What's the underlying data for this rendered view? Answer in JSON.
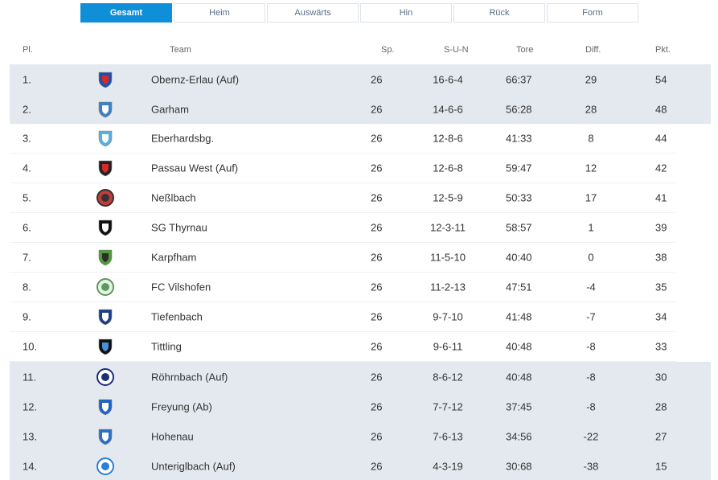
{
  "tabs": [
    {
      "label": "Gesamt",
      "active": true
    },
    {
      "label": "Heim",
      "active": false
    },
    {
      "label": "Auswärts",
      "active": false
    },
    {
      "label": "Hin",
      "active": false
    },
    {
      "label": "Rück",
      "active": false
    },
    {
      "label": "Form",
      "active": false
    }
  ],
  "headers": {
    "pl": "Pl.",
    "team": "Team",
    "sp": "Sp.",
    "sun": "S-U-N",
    "tore": "Tore",
    "diff": "Diff.",
    "pkt": "Pkt."
  },
  "colors": {
    "accent": "#0e8fd8",
    "shaded_row": "#e4e9ef"
  },
  "rows": [
    {
      "pl": "1.",
      "team": "Obernz-Erlau (Auf)",
      "sp": "26",
      "sun": "16-6-4",
      "tore": "66:37",
      "diff": "29",
      "pkt": "54",
      "shaded": true,
      "logo": "crest-red-blue",
      "c1": "#1f4fa8",
      "c2": "#d62a2a"
    },
    {
      "pl": "2.",
      "team": "Garham",
      "sp": "26",
      "sun": "14-6-6",
      "tore": "56:28",
      "diff": "28",
      "pkt": "48",
      "shaded": true,
      "logo": "crest-stripes-blue",
      "c1": "#3b7fc4",
      "c2": "#ffffff"
    },
    {
      "pl": "3.",
      "team": "Eberhardsbg.",
      "sp": "26",
      "sun": "12-8-6",
      "tore": "41:33",
      "diff": "8",
      "pkt": "44",
      "shaded": false,
      "logo": "crest-lightblue",
      "c1": "#5aaee0",
      "c2": "#ffffff"
    },
    {
      "pl": "4.",
      "team": "Passau West (Auf)",
      "sp": "26",
      "sun": "12-6-8",
      "tore": "59:47",
      "diff": "12",
      "pkt": "42",
      "shaded": false,
      "logo": "crest-red-black",
      "c1": "#222222",
      "c2": "#d62a2a"
    },
    {
      "pl": "5.",
      "team": "Neßlbach",
      "sp": "26",
      "sun": "12-5-9",
      "tore": "50:33",
      "diff": "17",
      "pkt": "41",
      "shaded": false,
      "logo": "crest-round-black",
      "c1": "#333333",
      "c2": "#c83a3a"
    },
    {
      "pl": "6.",
      "team": "SG Thyrnau",
      "sp": "26",
      "sun": "12-3-11",
      "tore": "58:57",
      "diff": "1",
      "pkt": "39",
      "shaded": false,
      "logo": "crest-black",
      "c1": "#111111",
      "c2": "#ffffff"
    },
    {
      "pl": "7.",
      "team": "Karpfham",
      "sp": "26",
      "sun": "11-5-10",
      "tore": "40:40",
      "diff": "0",
      "pkt": "38",
      "shaded": false,
      "logo": "crest-green",
      "c1": "#4f9a3a",
      "c2": "#2d2d2d"
    },
    {
      "pl": "8.",
      "team": "FC Vilshofen",
      "sp": "26",
      "sun": "11-2-13",
      "tore": "47:51",
      "diff": "-4",
      "pkt": "35",
      "shaded": false,
      "logo": "crest-round-green",
      "c1": "#5a9a5a",
      "c2": "#e8f3e8"
    },
    {
      "pl": "9.",
      "team": "Tiefenbach",
      "sp": "26",
      "sun": "9-7-10",
      "tore": "41:48",
      "diff": "-7",
      "pkt": "34",
      "shaded": false,
      "logo": "crest-navy",
      "c1": "#1f3f8a",
      "c2": "#ffffff"
    },
    {
      "pl": "10.",
      "team": "Tittling",
      "sp": "26",
      "sun": "9-6-11",
      "tore": "40:48",
      "diff": "-8",
      "pkt": "33",
      "shaded": false,
      "logo": "crest-black-blue",
      "c1": "#111111",
      "c2": "#4a90d9"
    },
    {
      "pl": "11.",
      "team": "Röhrnbach (Auf)",
      "sp": "26",
      "sun": "8-6-12",
      "tore": "40:48",
      "diff": "-8",
      "pkt": "30",
      "shaded": true,
      "logo": "crest-round-navy",
      "c1": "#1c2f7a",
      "c2": "#ffffff"
    },
    {
      "pl": "12.",
      "team": "Freyung (Ab)",
      "sp": "26",
      "sun": "7-7-12",
      "tore": "37:45",
      "diff": "-8",
      "pkt": "28",
      "shaded": true,
      "logo": "crest-blue-stripe",
      "c1": "#1e63c4",
      "c2": "#ffffff"
    },
    {
      "pl": "13.",
      "team": "Hohenau",
      "sp": "26",
      "sun": "7-6-13",
      "tore": "34:56",
      "diff": "-22",
      "pkt": "27",
      "shaded": true,
      "logo": "crest-blue-white",
      "c1": "#2b6fc7",
      "c2": "#ffffff"
    },
    {
      "pl": "14.",
      "team": "Unteriglbach (Auf)",
      "sp": "26",
      "sun": "4-3-19",
      "tore": "30:68",
      "diff": "-38",
      "pkt": "15",
      "shaded": true,
      "logo": "crest-ball-blue",
      "c1": "#2a7fd4",
      "c2": "#ffffff"
    }
  ]
}
